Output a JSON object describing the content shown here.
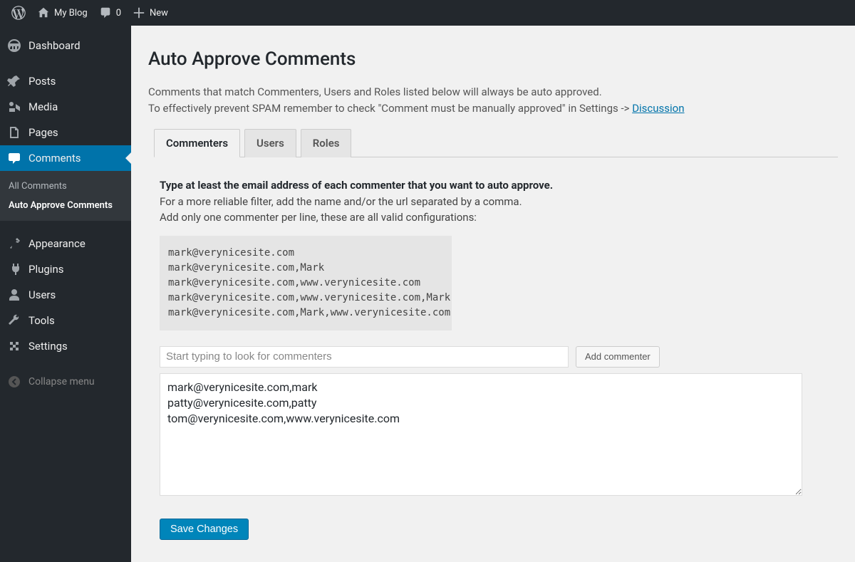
{
  "adminbar": {
    "site_name": "My Blog",
    "comment_count": "0",
    "new_label": "New"
  },
  "sidebar": {
    "items": [
      {
        "label": "Dashboard"
      },
      {
        "label": "Posts"
      },
      {
        "label": "Media"
      },
      {
        "label": "Pages"
      },
      {
        "label": "Comments"
      },
      {
        "label": "Appearance"
      },
      {
        "label": "Plugins"
      },
      {
        "label": "Users"
      },
      {
        "label": "Tools"
      },
      {
        "label": "Settings"
      }
    ],
    "submenu": [
      "All Comments",
      "Auto Approve Comments"
    ],
    "collapse_label": "Collapse menu"
  },
  "page": {
    "title": "Auto Approve Comments",
    "intro_line1": "Comments that match Commenters, Users and Roles listed below will always be auto approved.",
    "intro_line2_a": "To effectively prevent SPAM remember to check \"Comment must be manually approved\" in Settings -> ",
    "intro_link": "Discussion"
  },
  "tabs": [
    "Commenters",
    "Users",
    "Roles"
  ],
  "panel": {
    "heading": "Type at least the email address of each commenter that you want to auto approve.",
    "sub1": "For a more reliable filter, add the name and/or the url separated by a comma.",
    "sub2": "Add only one commenter per line, these are all valid configurations:",
    "examples": "mark@verynicesite.com\nmark@verynicesite.com,Mark\nmark@verynicesite.com,www.verynicesite.com\nmark@verynicesite.com,www.verynicesite.com,Mark\nmark@verynicesite.com,Mark,www.verynicesite.com",
    "lookup_placeholder": "Start typing to look for commenters",
    "add_button": "Add commenter",
    "textarea_value": "mark@verynicesite.com,mark\npatty@verynicesite.com,patty\ntom@verynicesite.com,www.verynicesite.com",
    "save_button": "Save Changes"
  }
}
